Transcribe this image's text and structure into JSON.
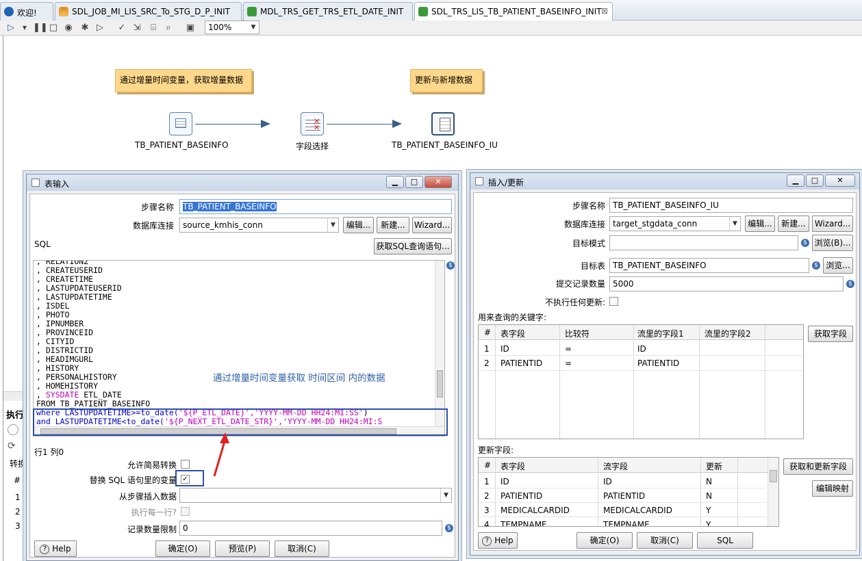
{
  "tabs": [
    {
      "label": "欢迎!",
      "icon": "welcome-icon",
      "color": "#1e63b6"
    },
    {
      "label": "SDL_JOB_MI_LIS_SRC_To_STG_D_P_INIT",
      "icon": "job-icon",
      "color": "#e08a1e"
    },
    {
      "label": "MDL_TRS_GET_TRS_ETL_DATE_INIT",
      "icon": "transformation-icon",
      "color": "#3a9a3a"
    },
    {
      "label": "SDL_TRS_LIS_TB_PATIENT_BASEINFO_INIT",
      "icon": "transformation-icon",
      "color": "#3a9a3a",
      "close": "⊠"
    }
  ],
  "toolbar": {
    "zoom": "100%"
  },
  "canvas": {
    "notes": [
      "通过增量时间变量，获取增量数据",
      "更新与新增数据"
    ],
    "steps": [
      "TB_PATIENT_BASEINFO",
      "字段选择",
      "TB_PATIENT_BASEINFO_IU"
    ]
  },
  "behind": {
    "exec_label": "执行",
    "tab_label": "转换",
    "row_hash": "#",
    "rows": [
      "1",
      "2",
      "3"
    ]
  },
  "table_input": {
    "title": "表输入",
    "step_name_label": "步骤名称",
    "step_name": "TB_PATIENT_BASEINFO",
    "db_label": "数据库连接",
    "db_value": "source_kmhis_conn",
    "edit": "编辑...",
    "new": "新建...",
    "wizard": "Wizard...",
    "sql_label": "SQL",
    "get_sql": "获取SQL查询语句...",
    "sql_lines": [
      ", RELATION2",
      ", CREATEUSERID",
      ", CREATETIME",
      ", LASTUPDATEUSERID",
      ", LASTUPDATETIME",
      ", ISDEL",
      ", PHOTO",
      ", IPNUMBER",
      ", PROVINCEID",
      ", CITYID",
      ", DISTRICTID",
      ", HEADIMGURL",
      ", HISTORY",
      ", PERSONALHISTORY",
      ", HOMEHISTORY"
    ],
    "sql_sysdate": "SYSDATE",
    "sql_sysdate_rest": " ETL_DATE",
    "sql_from": "FROM TB_PATIENT_BASEINFO",
    "sql_where_1a": "where LASTUPDATETIME>=",
    "sql_where_1b": "to_date(",
    "sql_where_1c": "'${P_ETL_DATE}','YYYY-MM-DD HH24:MI:SS'",
    "sql_where_1d": ")",
    "sql_where_2a": "and LASTUPDATETIME<",
    "sql_where_2b": "to_date(",
    "sql_where_2c": "'${P_NEXT_ETL_DATE_STR}','YYYY-MM-DD HH24:MI:S",
    "annotation": "通过增量时间变量获取 时间区间 内的数据",
    "position": "行1 列0",
    "allow_lazy": "允许简易转换",
    "replace_vars": "替换 SQL 语句里的变量",
    "from_step": "从步骤插入数据",
    "exec_each": "执行每一行?",
    "limit_label": "记录数量限制",
    "limit_value": "0",
    "help": "Help",
    "ok": "确定(O)",
    "preview": "预览(P)",
    "cancel": "取消(C)"
  },
  "insert_update": {
    "title": "插入/更新",
    "step_name_label": "步骤名称",
    "step_name": "TB_PATIENT_BASEINFO_IU",
    "db_label": "数据库连接",
    "db_value": "target_stgdata_conn",
    "edit": "编辑...",
    "new": "新建...",
    "wizard": "Wizard...",
    "schema_label": "目标模式",
    "schema_value": "",
    "browse_b": "浏览(B)...",
    "table_label": "目标表",
    "table_value": "TB_PATIENT_BASEINFO",
    "browse": "浏览...",
    "commit_label": "提交记录数量",
    "commit_value": "5000",
    "no_update_label": "不执行任何更新:",
    "keys_label": "用来查询的关键字:",
    "get_fields": "获取字段",
    "keys_headers": [
      "#",
      "表字段",
      "比较符",
      "流里的字段1",
      "流里的字段2"
    ],
    "keys_rows": [
      [
        "1",
        "ID",
        "=",
        "ID",
        ""
      ],
      [
        "2",
        "PATIENTID",
        "=",
        "PATIENTID",
        ""
      ]
    ],
    "update_label": "更新字段:",
    "get_update_fields": "获取和更新字段",
    "edit_mapping": "编辑映射",
    "update_headers": [
      "#",
      "表字段",
      "流字段",
      "更新"
    ],
    "update_rows": [
      [
        "1",
        "ID",
        "ID",
        "N"
      ],
      [
        "2",
        "PATIENTID",
        "PATIENTID",
        "N"
      ],
      [
        "3",
        "MEDICALCARDID",
        "MEDICALCARDID",
        "Y"
      ],
      [
        "4",
        "TEMPNAME",
        "TEMPNAME",
        "Y"
      ]
    ],
    "help": "Help",
    "ok": "确定(O)",
    "cancel": "取消(C)",
    "sql": "SQL"
  }
}
